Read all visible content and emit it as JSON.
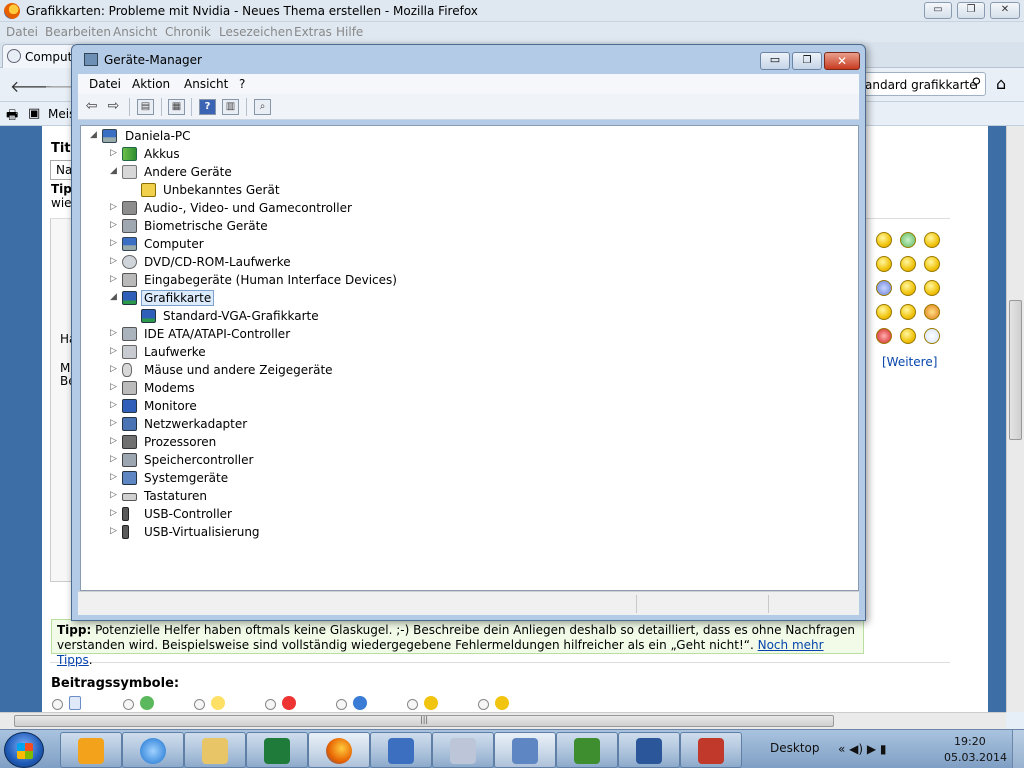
{
  "firefox": {
    "title": "Grafikkarten: Probleme mit Nvidia - Neues Thema erstellen - Mozilla Firefox",
    "menu": [
      "Datei",
      "Bearbeiten",
      "Ansicht",
      "Chronik",
      "Lesezeichen",
      "Extras",
      "Hilfe"
    ],
    "tab_label": "Compute",
    "search_value": "andard grafikkarte",
    "bookmark_label": "Meis",
    "window_buttons": {
      "minimize": "▭",
      "restore": "❐",
      "close": "✕"
    }
  },
  "web": {
    "bleed": [
      "Tite",
      "Na",
      "Tipp",
      "wie",
      "Ha",
      "M",
      "Be"
    ],
    "tip_label": "Tipp:",
    "tip_text": " Potenzielle Helfer haben oftmals keine Glaskugel. ;-) Beschreibe dein Anliegen deshalb so detailliert, dass es ohne Nachfragen verstanden wird. Beispielsweise sind vollständig wiedergegebene Fehlermeldungen hilfreicher als ein „Geht nicht!“. ",
    "tip_link": "Noch mehr Tipps",
    "tip_end": ".",
    "beitragssymbole": "Beitragssymbole:",
    "weitere": "[Weitere]"
  },
  "devmgr": {
    "title": "Geräte-Manager",
    "menu": [
      "Datei",
      "Aktion",
      "Ansicht",
      "?"
    ],
    "root": "Daniela-PC",
    "nodes": [
      {
        "label": "Akkus",
        "icon": "battery-icon"
      },
      {
        "label": "Andere Geräte",
        "icon": "other-devices-icon"
      },
      {
        "label": "Unbekanntes Gerät",
        "icon": "warning-icon"
      },
      {
        "label": "Audio-, Video- und Gamecontroller",
        "icon": "speaker-icon"
      },
      {
        "label": "Biometrische Geräte",
        "icon": "fingerprint-icon"
      },
      {
        "label": "Computer",
        "icon": "computer-icon"
      },
      {
        "label": "DVD/CD-ROM-Laufwerke",
        "icon": "disc-icon"
      },
      {
        "label": "Eingabegeräte (Human Interface Devices)",
        "icon": "hid-icon"
      },
      {
        "label": "Grafikkarte",
        "icon": "display-adapter-icon"
      },
      {
        "label": "Standard-VGA-Grafikkarte",
        "icon": "display-adapter-icon"
      },
      {
        "label": "IDE ATA/ATAPI-Controller",
        "icon": "ide-icon"
      },
      {
        "label": "Laufwerke",
        "icon": "drive-icon"
      },
      {
        "label": "Mäuse und andere Zeigegeräte",
        "icon": "mouse-icon"
      },
      {
        "label": "Modems",
        "icon": "modem-icon"
      },
      {
        "label": "Monitore",
        "icon": "monitor-icon"
      },
      {
        "label": "Netzwerkadapter",
        "icon": "network-icon"
      },
      {
        "label": "Prozessoren",
        "icon": "cpu-icon"
      },
      {
        "label": "Speichercontroller",
        "icon": "storage-icon"
      },
      {
        "label": "Systemgeräte",
        "icon": "system-icon"
      },
      {
        "label": "Tastaturen",
        "icon": "keyboard-icon"
      },
      {
        "label": "USB-Controller",
        "icon": "usb-icon"
      },
      {
        "label": "USB-Virtualisierung",
        "icon": "usb-icon"
      }
    ],
    "selected": "Grafikkarte",
    "toolbar_help": "?"
  },
  "taskbar": {
    "desktop": "Desktop",
    "tray": "« ◀) ▶ ▮",
    "time": "19:20",
    "date": "05.03.2014"
  },
  "colors": {
    "selection": "#dcebfc",
    "tip_bg": "#f1fbe8",
    "link": "#0645ad"
  }
}
